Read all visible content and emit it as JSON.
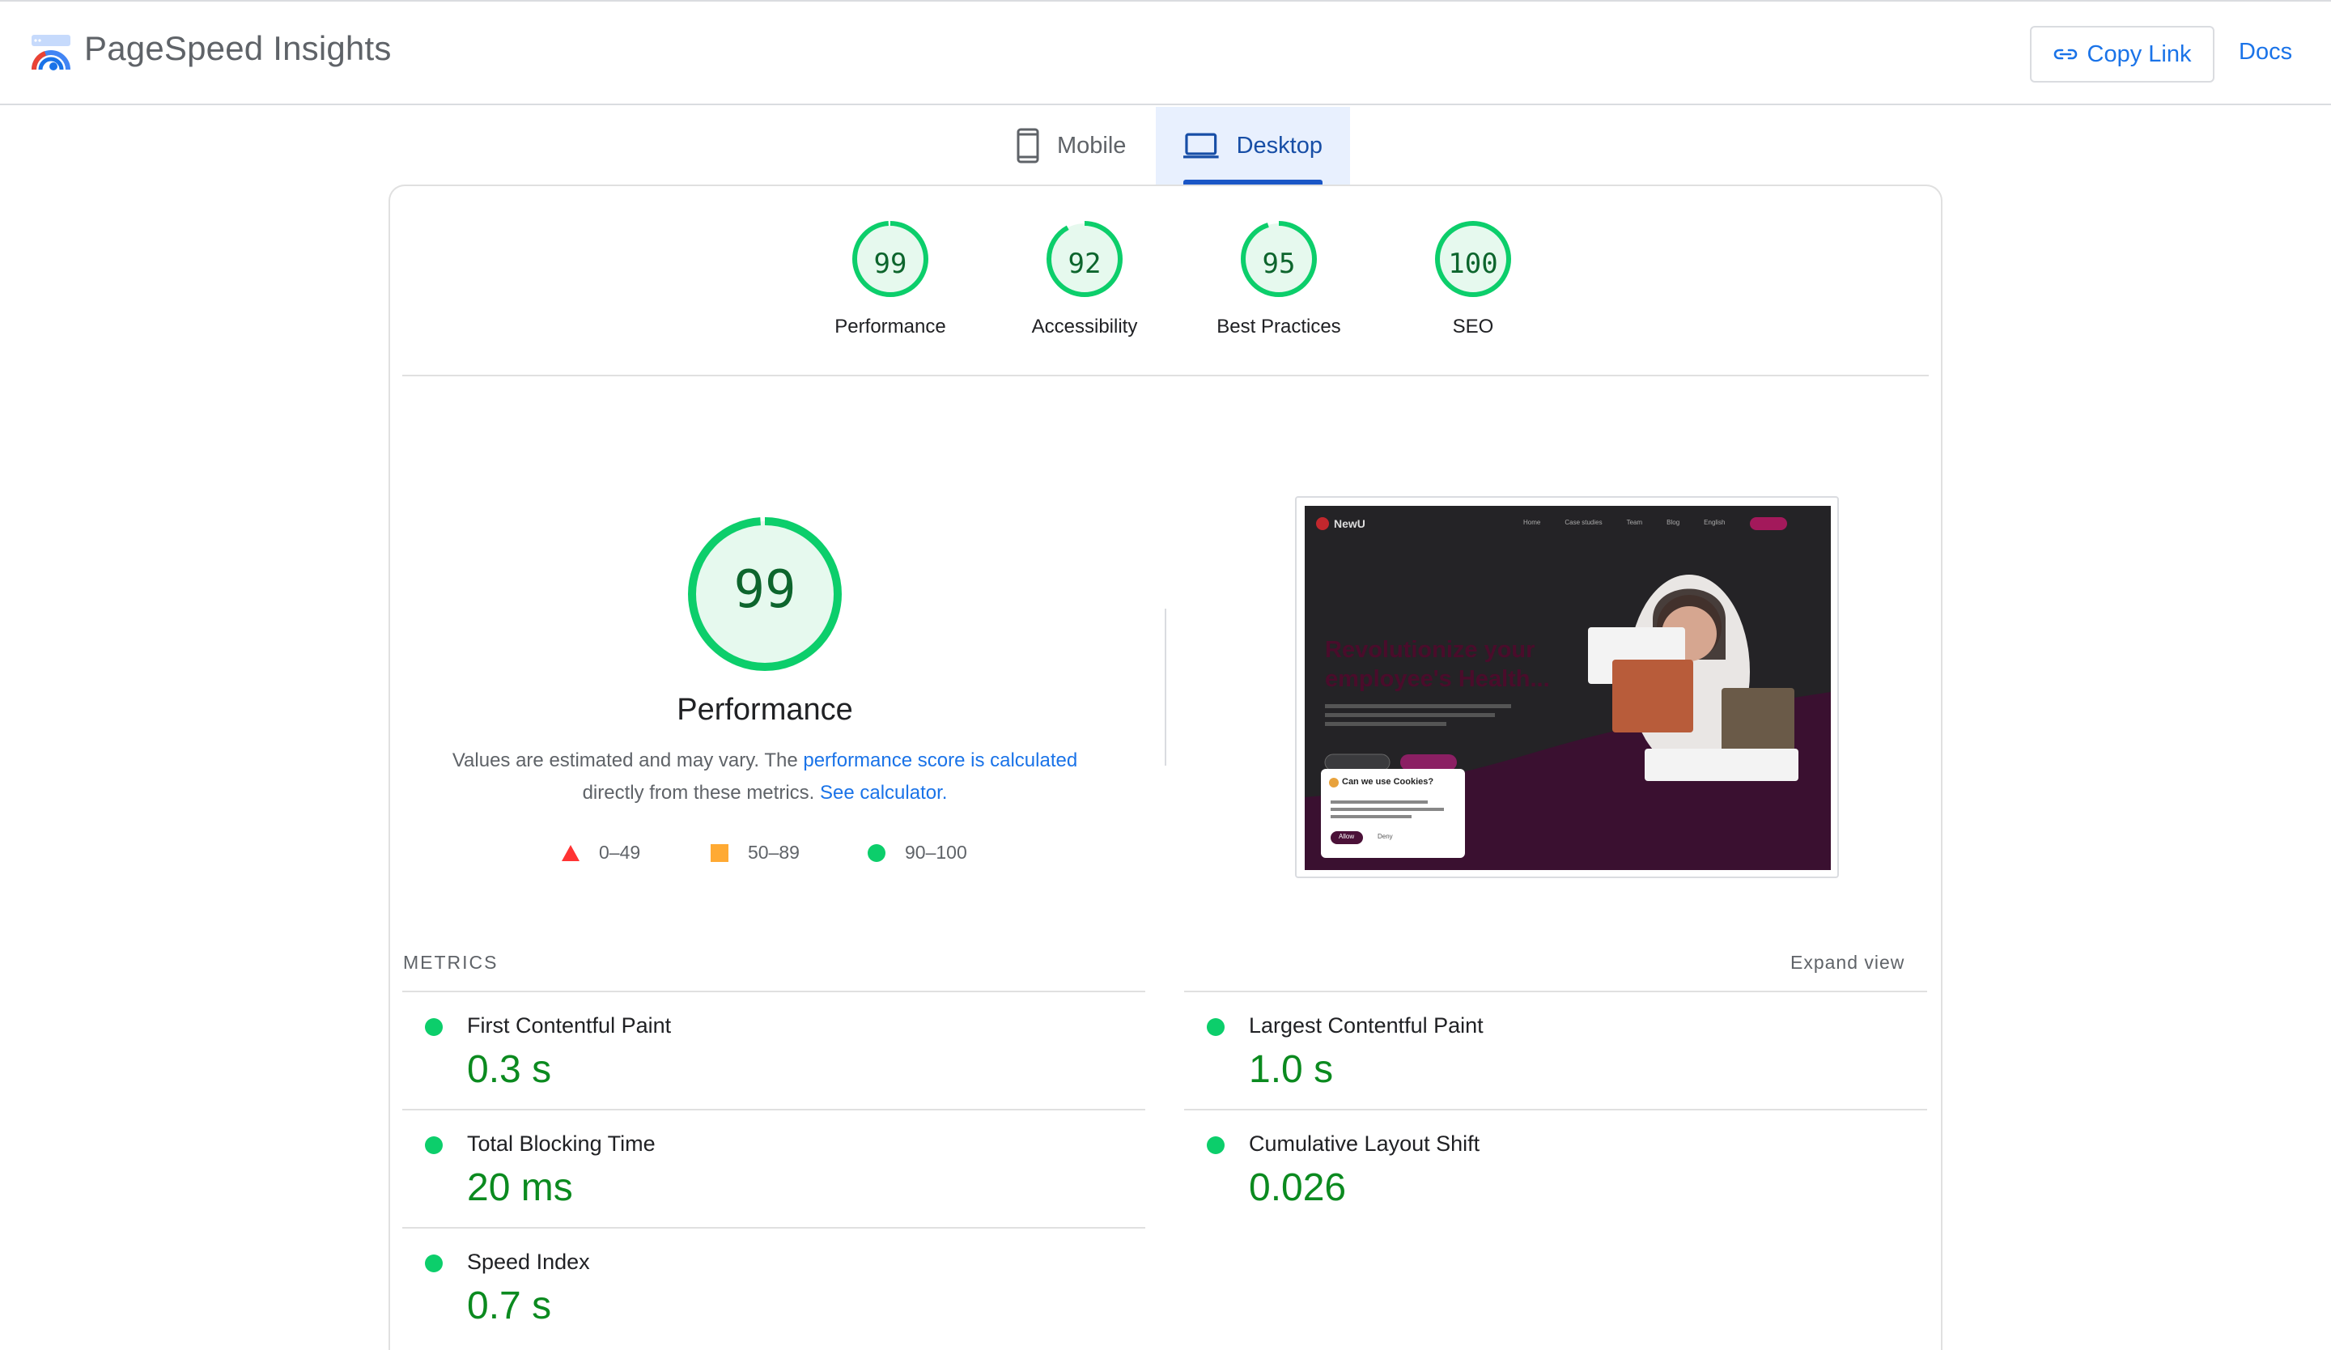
{
  "header": {
    "brand": "PageSpeed Insights",
    "copy_link_label": "Copy Link",
    "docs_label": "Docs"
  },
  "tabs": [
    {
      "label": "Mobile",
      "icon": "phone-icon",
      "active": false
    },
    {
      "label": "Desktop",
      "icon": "laptop-icon",
      "active": true
    }
  ],
  "scores": [
    {
      "label": "Performance",
      "value": "99",
      "fraction": 0.99
    },
    {
      "label": "Accessibility",
      "value": "92",
      "fraction": 0.92
    },
    {
      "label": "Best Practices",
      "value": "95",
      "fraction": 0.95
    },
    {
      "label": "SEO",
      "value": "100",
      "fraction": 1.0
    }
  ],
  "performance": {
    "score": "99",
    "score_fraction": 0.99,
    "title": "Performance",
    "desc_prefix": "Values are estimated and may vary. The ",
    "desc_link1": "performance score is calculated",
    "desc_middle": "directly from these metrics. ",
    "desc_link2": "See calculator."
  },
  "legend": [
    {
      "shape": "triangle",
      "color": "#ff3333",
      "range": "0–49"
    },
    {
      "shape": "square",
      "color": "#ffaa33",
      "range": "50–89"
    },
    {
      "shape": "circle",
      "color": "#0cce6b",
      "range": "90–100"
    }
  ],
  "screenshot": {
    "site_name": "NewU",
    "nav": [
      "Home",
      "Case studies",
      "Team",
      "Blog"
    ],
    "language": "English",
    "headline_1": "Revolutionize your",
    "headline_2": "employee's Health...",
    "cookie_title": "Can we use Cookies?",
    "cookie_allow": "Allow",
    "cookie_deny": "Deny"
  },
  "metrics_section": {
    "label": "METRICS",
    "expand_label": "Expand view"
  },
  "metrics": [
    {
      "name": "First Contentful Paint",
      "value": "0.3 s"
    },
    {
      "name": "Largest Contentful Paint",
      "value": "1.0 s"
    },
    {
      "name": "Total Blocking Time",
      "value": "20 ms"
    },
    {
      "name": "Cumulative Layout Shift",
      "value": "0.026"
    },
    {
      "name": "Speed Index",
      "value": "0.7 s"
    }
  ],
  "colors": {
    "pass_green": "#0cce6b",
    "pass_text": "#0d652d",
    "accent_blue": "#1a73e8"
  }
}
